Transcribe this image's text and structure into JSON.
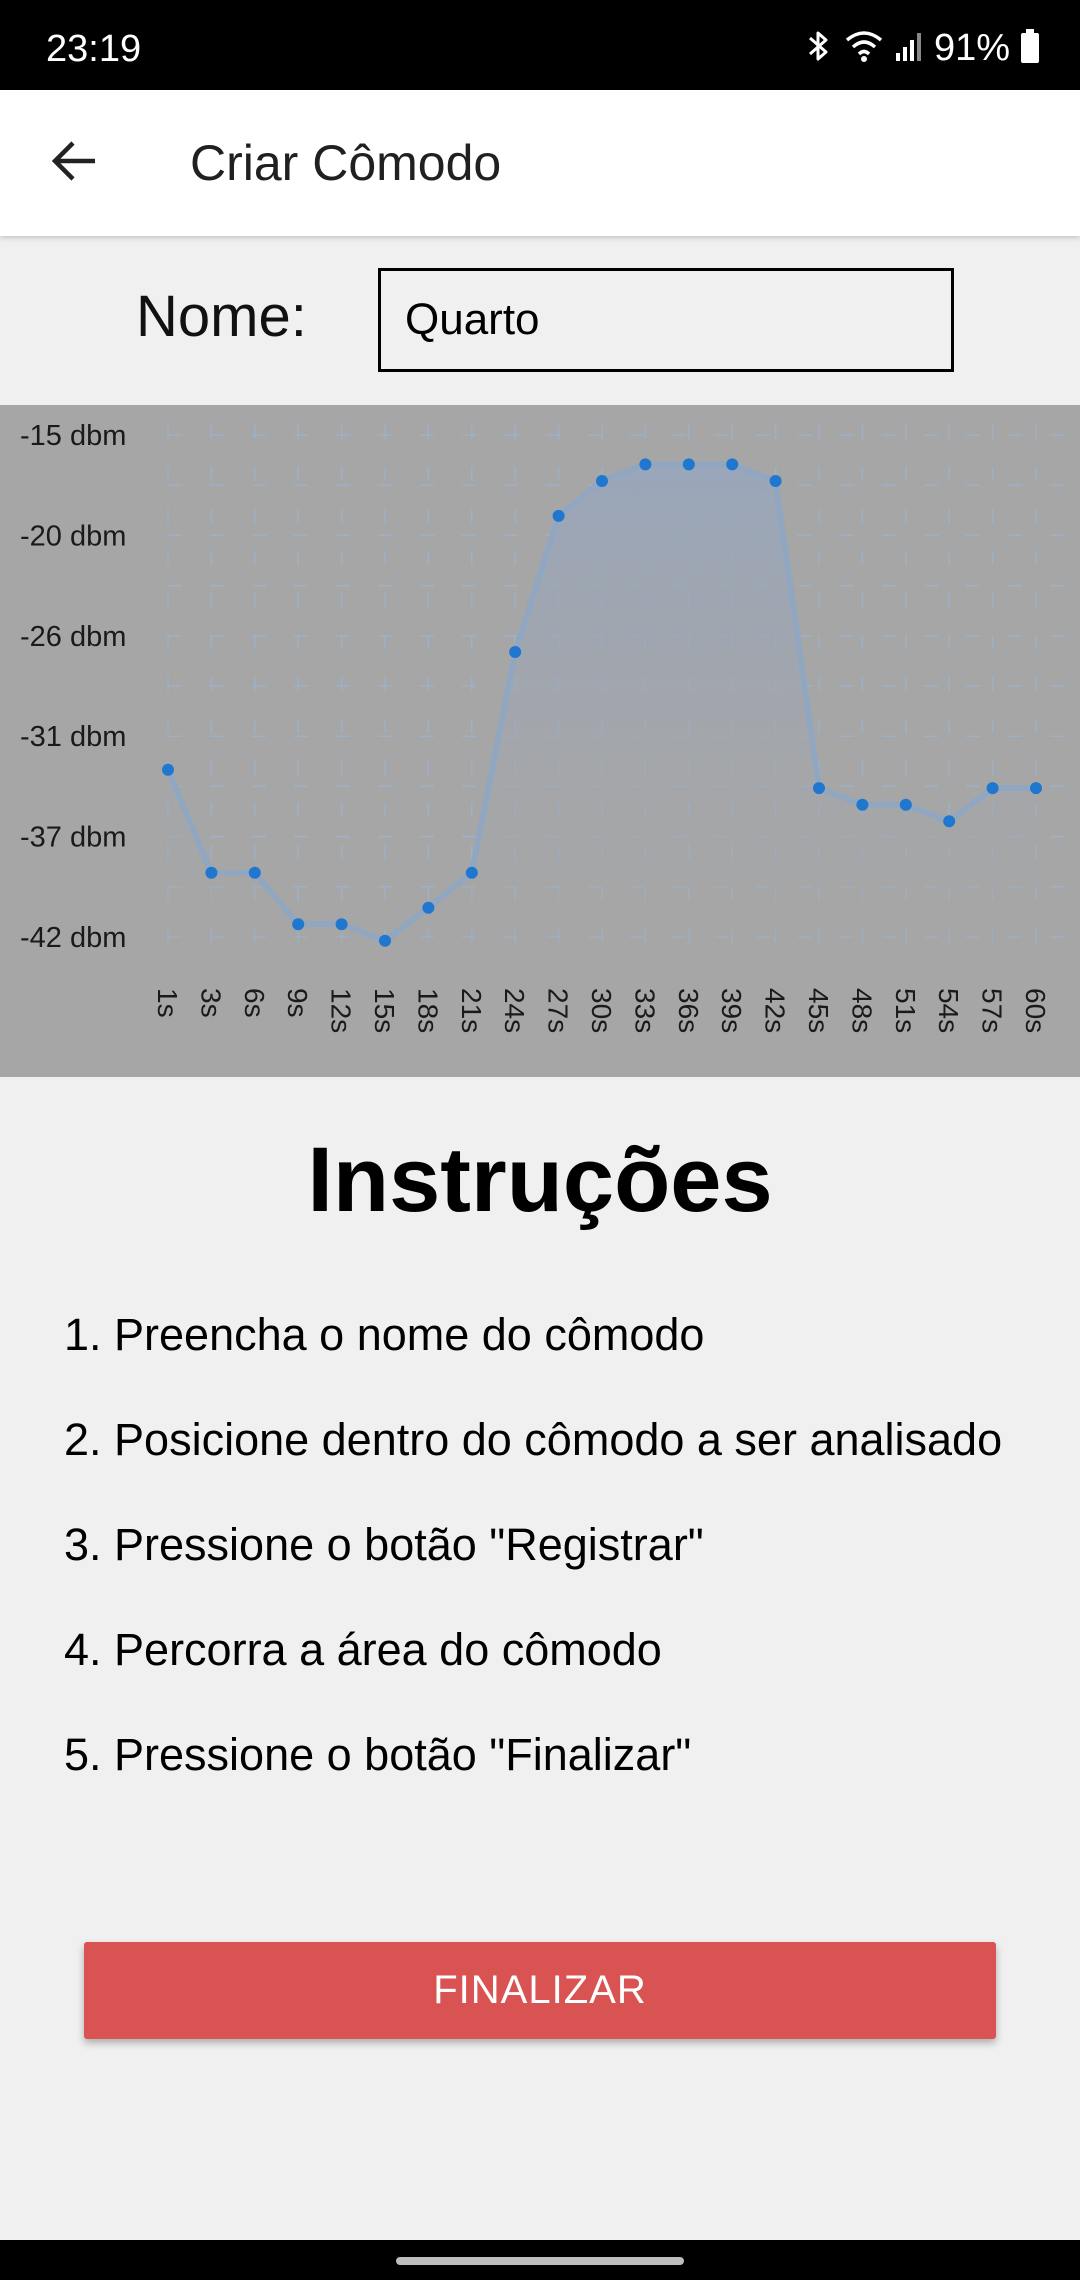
{
  "status_bar": {
    "time": "23:19",
    "battery": "91%",
    "icons": [
      "bluetooth-icon",
      "wifi-icon",
      "signal-icon",
      "battery-icon"
    ]
  },
  "app_bar": {
    "title": "Criar Cômodo",
    "back_icon": "arrow-left-icon"
  },
  "form": {
    "name_label": "Nome:",
    "name_value": "Quarto"
  },
  "chart_data": {
    "type": "line",
    "title": "",
    "xlabel": "",
    "ylabel": "",
    "y_tick_labels": [
      "-15 dbm",
      "-20 dbm",
      "-26 dbm",
      "-31 dbm",
      "-37 dbm",
      "-42 dbm"
    ],
    "ylim": [
      -43,
      -15
    ],
    "categories": [
      "1s",
      "3s",
      "6s",
      "9s",
      "12s",
      "15s",
      "18s",
      "21s",
      "24s",
      "27s",
      "30s",
      "33s",
      "36s",
      "39s",
      "42s",
      "45s",
      "48s",
      "51s",
      "54s",
      "57s",
      "60s"
    ],
    "values": [
      -33.2,
      -38.8,
      -38.8,
      -41.6,
      -41.6,
      -42.5,
      -40.7,
      -38.8,
      -26.8,
      -19.4,
      -17.5,
      -16.6,
      -16.6,
      -16.6,
      -17.5,
      -34.2,
      -35.1,
      -35.1,
      -36.0,
      -34.2,
      -34.2
    ],
    "grid": true,
    "colors": {
      "line": "#8fa6c2",
      "point": "#1f77d0",
      "area_top": "#98a6bc",
      "background": "#a6a6a6",
      "grid": "#9ab3d0"
    }
  },
  "instructions": {
    "title": "Instruções",
    "steps": [
      "1. Preencha o nome do cômodo",
      "2. Posicione dentro do cômodo a ser analisado",
      "3. Pressione o botão \"Registrar\"",
      "4. Percorra a área do cômodo",
      "5. Pressione o botão \"Finalizar\""
    ]
  },
  "actions": {
    "finalize_label": "FINALIZAR",
    "finalize_color": "#d95353"
  }
}
